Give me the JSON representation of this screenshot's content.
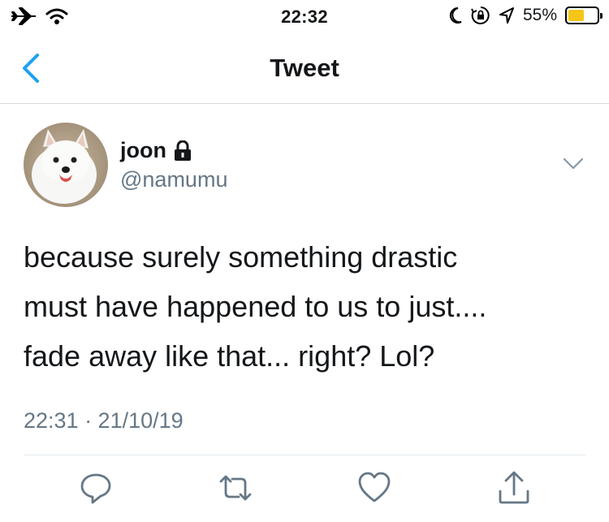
{
  "status_bar": {
    "time": "22:32",
    "battery_percent": "55%",
    "battery_level": 0.55,
    "battery_color": "#f5c518",
    "icons": [
      "airplane-icon",
      "wifi-icon",
      "moon-icon",
      "orientation-lock-icon",
      "location-arrow-icon",
      "battery-icon"
    ]
  },
  "nav": {
    "title": "Tweet",
    "back_icon": "chevron-left-icon",
    "accent_color": "#1da1f2"
  },
  "tweet": {
    "author": {
      "display_name": "joon",
      "username": "@namumu",
      "protected": true
    },
    "text": "because surely something drastic\nmust have happened to us to just....\nfade away like that... right? Lol?",
    "timestamp": "22:31 · 21/10/19"
  },
  "actions": [
    {
      "name": "reply",
      "icon": "reply-icon"
    },
    {
      "name": "retweet",
      "icon": "retweet-icon"
    },
    {
      "name": "like",
      "icon": "heart-icon"
    },
    {
      "name": "share",
      "icon": "share-icon"
    }
  ]
}
